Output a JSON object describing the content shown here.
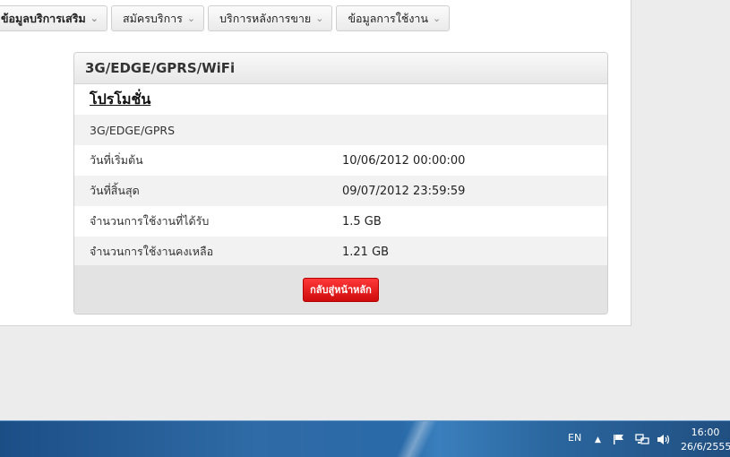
{
  "nav": {
    "items": [
      {
        "label": "ข้อมูลบริการเสริม"
      },
      {
        "label": "สมัครบริการ"
      },
      {
        "label": "บริการหลังการขาย"
      },
      {
        "label": "ข้อมูลการใช้งาน"
      }
    ]
  },
  "panel": {
    "title": "3G/EDGE/GPRS/WiFi",
    "promo_heading": "โปรโมชั่น",
    "service_name": "3G/EDGE/GPRS",
    "rows": [
      {
        "label": "วันที่เริ่มต้น",
        "value": "10/06/2012 00:00:00"
      },
      {
        "label": "วันที่สิ้นสุด",
        "value": "09/07/2012 23:59:59"
      },
      {
        "label": "จำนวนการใช้งานที่ได้รับ",
        "value": "1.5 GB"
      },
      {
        "label": "จำนวนการใช้งานคงเหลือ",
        "value": "1.21 GB"
      }
    ],
    "back_button": "กลับสู่หน้าหลัก"
  },
  "taskbar": {
    "language": "EN",
    "time": "16:00",
    "date": "26/6/2555",
    "icons": [
      "show-hidden-icons",
      "action-center-flag",
      "network",
      "volume"
    ]
  },
  "colors": {
    "back_button": "#e01414",
    "taskbar": "#2a6aa8"
  }
}
